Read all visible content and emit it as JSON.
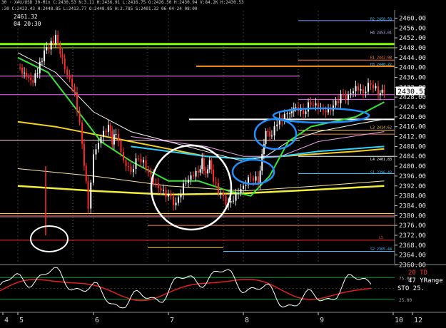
{
  "header": {
    "line1": "30 · XAU/USD 30-Min  C:2430.53  N:3.11  H:2436.91  L:2416.75  O:2426.50  H:2430.94  V:84.2K  H:2430.53",
    "line2": ":30  C:2423.43  H:2448.85  L:2413.77  O:2448.85  H:2.785  S:2401.32  06-04-24  08:00",
    "hover_price": "2461.32",
    "hover_time": "04 20:30"
  },
  "colors": {
    "background": "#000000",
    "candle": "#ff2a2a",
    "ma_green": "#34e534",
    "ma_yellow": "#f2ee3a",
    "ma_white": "#f4f4f4",
    "ma_pink": "#f0a0f0",
    "ellipse_blue": "#1e90ff",
    "ellipse_white": "#ffffff",
    "stoch_white": "#ffffff",
    "stoch_red": "#e02020"
  },
  "chart_data": {
    "type": "candlestick",
    "symbol": "XAU/USD",
    "interval": "30-Min",
    "x_ticks": [
      "4",
      "5",
      "6",
      "7",
      "8",
      "9",
      "10",
      "12"
    ],
    "y_ticks": [
      "2460.00",
      "2456.00",
      "2452.00",
      "2448.00",
      "2444.00",
      "2440.00",
      "2436.00",
      "2432.00",
      "2428.00",
      "2424.00",
      "2420.00",
      "2416.00",
      "2412.00",
      "2408.00",
      "2404.00",
      "2400.00",
      "2396.00",
      "2392.00",
      "2388.00",
      "2384.00",
      "2380.00",
      "2376.00",
      "2372.00",
      "2368.00",
      "2364.00",
      "2360.00"
    ],
    "ylim": [
      2360,
      2462
    ],
    "last_price": "2430.53",
    "price_path": [
      [
        0.0,
        2440
      ],
      [
        0.2,
        2434
      ],
      [
        0.35,
        2446
      ],
      [
        0.5,
        2452
      ],
      [
        0.62,
        2440
      ],
      [
        0.75,
        2430
      ],
      [
        0.85,
        2410
      ],
      [
        0.93,
        2384
      ],
      [
        1.0,
        2404
      ],
      [
        1.1,
        2412
      ],
      [
        1.2,
        2416
      ],
      [
        1.25,
        2410
      ],
      [
        1.3,
        2414
      ],
      [
        1.4,
        2402
      ],
      [
        1.5,
        2398
      ],
      [
        1.6,
        2404
      ],
      [
        1.7,
        2400
      ],
      [
        1.8,
        2394
      ],
      [
        1.9,
        2390
      ],
      [
        2.0,
        2388
      ],
      [
        2.1,
        2384
      ],
      [
        2.2,
        2392
      ],
      [
        2.3,
        2396
      ],
      [
        2.4,
        2398
      ],
      [
        2.45,
        2402
      ],
      [
        2.5,
        2396
      ],
      [
        2.55,
        2402
      ],
      [
        2.6,
        2394
      ],
      [
        2.7,
        2388
      ],
      [
        2.8,
        2384
      ],
      [
        2.9,
        2388
      ],
      [
        3.0,
        2392
      ],
      [
        3.1,
        2396
      ],
      [
        3.2,
        2394
      ],
      [
        3.25,
        2404
      ],
      [
        3.3,
        2414
      ],
      [
        3.38,
        2412
      ],
      [
        3.45,
        2418
      ],
      [
        3.55,
        2420
      ],
      [
        3.62,
        2422
      ],
      [
        3.7,
        2424
      ],
      [
        3.8,
        2422
      ],
      [
        3.9,
        2426
      ],
      [
        4.0,
        2424
      ],
      [
        4.1,
        2422
      ],
      [
        4.2,
        2424
      ],
      [
        4.3,
        2428
      ],
      [
        4.4,
        2428
      ],
      [
        4.5,
        2432
      ],
      [
        4.6,
        2430
      ],
      [
        4.7,
        2434
      ],
      [
        4.8,
        2430
      ],
      [
        4.88,
        2430.5
      ]
    ],
    "levels": [
      {
        "label": "R2 2458.58",
        "value": 2458.6,
        "color": "#40c0ff"
      },
      {
        "label": "H4 2453.01",
        "value": 2453.0,
        "color": "#c0c0ff"
      },
      {
        "label": "R1 2442.98",
        "value": 2443.0,
        "color": "#ff8040"
      },
      {
        "label": "H3 2440.22",
        "value": 2440.2,
        "color": "#40c0ff"
      },
      {
        "label": "L3 2414.62",
        "value": 2414.6,
        "color": "#ffd040"
      },
      {
        "label": "L4 2401.83",
        "value": 2401.8,
        "color": "#ffffff"
      },
      {
        "label": "S1 2396.43",
        "value": 2396.4,
        "color": "#40c0ff"
      },
      {
        "label": "S2 2365.44",
        "value": 2365.4,
        "color": "#40c0ff"
      },
      {
        "label": "L5",
        "value": 2370.0,
        "color": "#ff3030"
      }
    ],
    "indicator": {
      "labels": [
        "20 TD",
        "47 YRange",
        "STO  25."
      ],
      "ticks": [
        "75.00",
        "25.00"
      ]
    }
  }
}
